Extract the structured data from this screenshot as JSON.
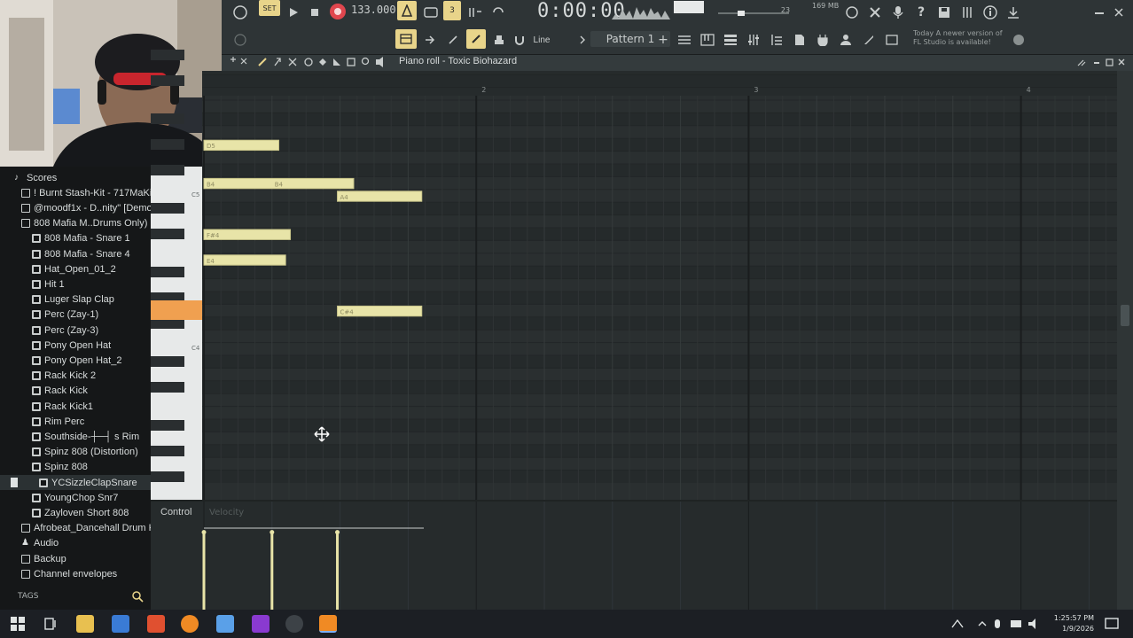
{
  "toolbar": {
    "tempo": "133.000",
    "time": "0:00:00",
    "memory": "169 MB",
    "cpu_count": "23",
    "snap_mode": "Line",
    "pattern": "Pattern 1",
    "hint_line1": "Today  A newer version of",
    "hint_line2": "FL Studio is available!",
    "mode_label": "SET"
  },
  "piano_roll": {
    "title": "Piano roll - Toxic Biohazard",
    "bar_2": "2",
    "bar_3": "3",
    "bar_4": "4",
    "key_c5": "C5",
    "key_c4": "C4",
    "notes": [
      {
        "label": "D5",
        "key_index": 3,
        "start_beat": 0,
        "length_beats": 1.1
      },
      {
        "label": "B4",
        "key_index": 6,
        "start_beat": 0,
        "length_beats": 2.2
      },
      {
        "label": "A4",
        "key_index": 7,
        "start_beat": 1.96,
        "length_beats": 1.24
      },
      {
        "label": "F#4",
        "key_index": 10,
        "start_beat": 0,
        "length_beats": 1.27
      },
      {
        "label": "E4",
        "key_index": 12,
        "start_beat": 0,
        "length_beats": 1.2
      },
      {
        "label": "C#4",
        "key_index": 16,
        "start_beat": 1.96,
        "length_beats": 1.24
      }
    ],
    "secondary_note_label": "B4"
  },
  "velocity": {
    "header": "Control",
    "sub": "Velocity",
    "bars": [
      {
        "beat": 0,
        "value": 0.95
      },
      {
        "beat": 1,
        "value": 0.95
      },
      {
        "beat": 1.96,
        "value": 0.95
      }
    ]
  },
  "browser": {
    "items": [
      {
        "type": "scores",
        "indent": 1,
        "label": "Scores"
      },
      {
        "type": "folder",
        "indent": 2,
        "label": "! Burnt Stash-Kit - 717MaKid"
      },
      {
        "type": "folder",
        "indent": 2,
        "label": "@moodf1x - D..nity\" [Demo]"
      },
      {
        "type": "folder",
        "indent": 2,
        "label": "808 Mafia M..Drums Only)"
      },
      {
        "type": "file",
        "indent": 3,
        "label": "808 Mafia - Snare 1"
      },
      {
        "type": "file",
        "indent": 3,
        "label": "808 Mafia - Snare 4"
      },
      {
        "type": "file",
        "indent": 3,
        "label": "Hat_Open_01_2"
      },
      {
        "type": "file",
        "indent": 3,
        "label": "Hit 1"
      },
      {
        "type": "file",
        "indent": 3,
        "label": "Luger Slap Clap"
      },
      {
        "type": "file",
        "indent": 3,
        "label": "Perc (Zay-1)"
      },
      {
        "type": "file",
        "indent": 3,
        "label": "Perc (Zay-3)"
      },
      {
        "type": "file",
        "indent": 3,
        "label": "Pony Open Hat"
      },
      {
        "type": "file",
        "indent": 3,
        "label": "Pony Open Hat_2"
      },
      {
        "type": "file",
        "indent": 3,
        "label": "Rack Kick 2"
      },
      {
        "type": "file",
        "indent": 3,
        "label": "Rack Kick"
      },
      {
        "type": "file",
        "indent": 3,
        "label": "Rack Kick1"
      },
      {
        "type": "file",
        "indent": 3,
        "label": "Rim Perc"
      },
      {
        "type": "file",
        "indent": 3,
        "label": "Southside-┼─┤ s Rim"
      },
      {
        "type": "file",
        "indent": 3,
        "label": "Spinz 808 (Distortion)"
      },
      {
        "type": "file",
        "indent": 3,
        "label": "Spinz 808"
      },
      {
        "type": "file",
        "indent": 4,
        "label": "YCSizzleClapSnare"
      },
      {
        "type": "file",
        "indent": 3,
        "label": "YoungChop Snr7"
      },
      {
        "type": "file",
        "indent": 3,
        "label": "Zayloven Short 808"
      },
      {
        "type": "folder",
        "indent": 2,
        "label": "Afrobeat_Dancehall Drum Kit"
      },
      {
        "type": "user",
        "indent": 2,
        "label": "Audio"
      },
      {
        "type": "folder",
        "indent": 2,
        "label": "Backup"
      },
      {
        "type": "folder",
        "indent": 2,
        "label": "Channel envelopes"
      }
    ],
    "tags_label": "TAGS"
  },
  "taskbar": {
    "time": "1:25:57 PM",
    "date": "1/9/2026"
  },
  "colors": {
    "note": "#e8e4a8",
    "note_border": "#c9c58a",
    "grid_bg": "#2a2f30",
    "accent_yellow": "#e8d48a",
    "record_red": "#e0464e",
    "orange_key": "#f0a050"
  }
}
